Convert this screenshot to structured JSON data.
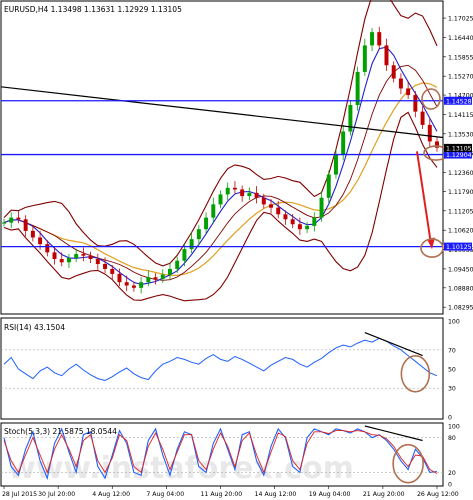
{
  "chart_data": [
    {
      "type": "line",
      "panel": "price",
      "title": "EURUSD,H4  1.13498 1.13631 1.12929 1.13105",
      "y_ticks": [
        "1.17025",
        "1.16440",
        "1.15855",
        "1.15270",
        "1.14700",
        "1.14115",
        "1.13530",
        "1.12945",
        "1.12360",
        "1.11790",
        "1.11205",
        "1.10620",
        "1.10035",
        "1.09450",
        "1.08880",
        "1.08295"
      ],
      "ylim": [
        1.0815,
        1.1745
      ],
      "horizontal_levels": [
        {
          "label": "1.14528",
          "value": 1.14528,
          "color": "#1a1aff"
        },
        {
          "label": "1.12904",
          "value": 1.12904,
          "color": "#1a1aff"
        },
        {
          "label": "1.10125",
          "value": 1.10125,
          "color": "#1a1aff"
        }
      ],
      "current_price": {
        "label": "1.13105",
        "value": 1.13105
      },
      "trendline": {
        "from": 1.1495,
        "to": 1.1342,
        "color": "#000000"
      },
      "close_path": [
        1.1085,
        1.11,
        1.1095,
        1.106,
        1.104,
        1.102,
        1.0995,
        1.0975,
        1.0965,
        1.0978,
        1.099,
        1.0985,
        1.0975,
        1.096,
        1.0945,
        1.093,
        1.0905,
        1.0895,
        1.0888,
        1.0905,
        1.092,
        1.0915,
        1.0928,
        1.0945,
        1.097,
        1.1005,
        1.1035,
        1.1065,
        1.11,
        1.114,
        1.117,
        1.119,
        1.1185,
        1.1165,
        1.1175,
        1.116,
        1.114,
        1.113,
        1.111,
        1.1095,
        1.108,
        1.1065,
        1.1075,
        1.11,
        1.116,
        1.123,
        1.129,
        1.136,
        1.144,
        1.154,
        1.162,
        1.166,
        1.162,
        1.156,
        1.152,
        1.149,
        1.147,
        1.142,
        1.138,
        1.133,
        1.1311
      ],
      "colors": {
        "ma_fast": "#2020cc",
        "ma_mid": "#e0a020",
        "bollinger": "#800000",
        "candle_bull": "#00a000",
        "candle_bear": "#c00000",
        "forecast_arrow": "#e02020",
        "marker": "#b07050"
      }
    },
    {
      "type": "line",
      "panel": "rsi",
      "title": "RSI(14) 43.1504",
      "y_ticks": [
        "100",
        "70",
        "50",
        "30",
        "0"
      ],
      "ylim": [
        0,
        100
      ],
      "levels": [
        70,
        30
      ],
      "values": [
        55,
        62,
        50,
        45,
        40,
        48,
        52,
        46,
        43,
        50,
        55,
        49,
        44,
        40,
        38,
        42,
        47,
        51,
        45,
        41,
        39,
        48,
        55,
        58,
        62,
        60,
        57,
        55,
        61,
        65,
        60,
        58,
        63,
        60,
        56,
        52,
        48,
        54,
        58,
        62,
        60,
        55,
        52,
        57,
        61,
        67,
        72,
        75,
        73,
        77,
        80,
        78,
        82,
        79,
        74,
        70,
        64,
        58,
        52,
        46,
        43
      ],
      "color": "#2060ff"
    },
    {
      "type": "line",
      "panel": "stochastic",
      "title": "Stoch(5,3,3) 21.5875 18.0544",
      "y_ticks": [
        "100",
        "80",
        "20",
        "0"
      ],
      "ylim": [
        0,
        100
      ],
      "levels": [
        80,
        20
      ],
      "series": [
        {
          "values": [
            80,
            30,
            15,
            60,
            90,
            40,
            10,
            70,
            95,
            55,
            20,
            85,
            90,
            30,
            10,
            50,
            92,
            70,
            20,
            15,
            75,
            95,
            50,
            15,
            60,
            90,
            85,
            30,
            20,
            70,
            95,
            60,
            25,
            85,
            90,
            40,
            15,
            65,
            95,
            80,
            30,
            20,
            80,
            95,
            90,
            85,
            95,
            92,
            88,
            95,
            90,
            80,
            85,
            75,
            60,
            40,
            25,
            60,
            45,
            20,
            21.6
          ],
          "color": "#2060ff"
        },
        {
          "values": [
            75,
            40,
            20,
            50,
            80,
            50,
            20,
            60,
            85,
            60,
            30,
            75,
            85,
            40,
            20,
            45,
            85,
            75,
            30,
            20,
            65,
            88,
            60,
            25,
            55,
            85,
            85,
            40,
            25,
            60,
            88,
            65,
            30,
            75,
            88,
            50,
            20,
            55,
            88,
            82,
            40,
            25,
            70,
            90,
            90,
            87,
            92,
            92,
            90,
            92,
            90,
            85,
            84,
            78,
            65,
            45,
            30,
            50,
            48,
            25,
            18.1
          ],
          "color": "#e02020"
        }
      ]
    }
  ],
  "x_ticks": [
    "28 Jul 2015",
    "30 Jul 20:00",
    "4 Aug 12:00",
    "7 Aug 04:00",
    "11 Aug 20:00",
    "14 Aug 12:00",
    "19 Aug 04:00",
    "21 Aug 20:00",
    "26 Aug 12:00"
  ],
  "watermark": "www.instaforex.com"
}
